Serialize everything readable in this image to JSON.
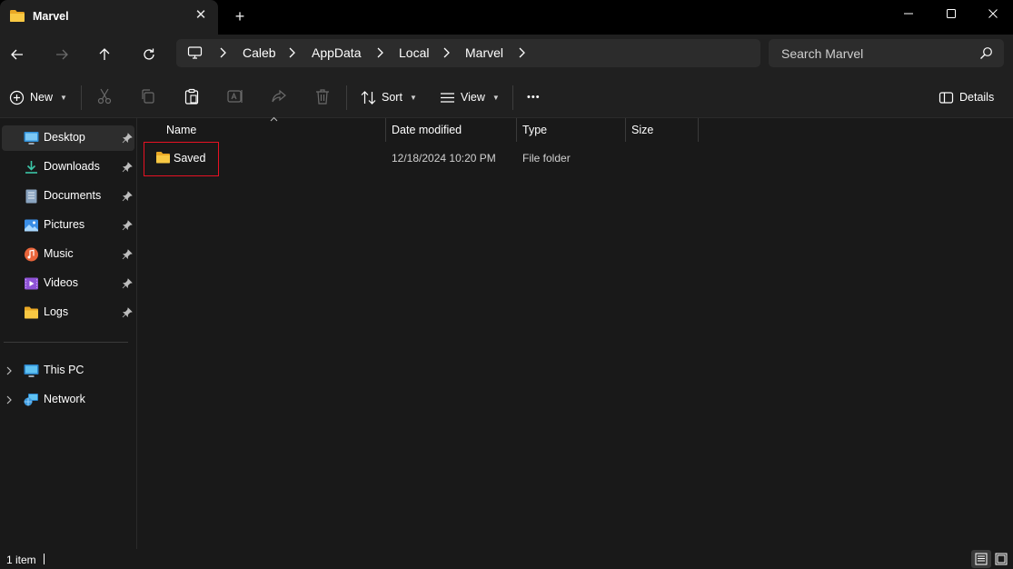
{
  "window": {
    "tab_title": "Marvel",
    "new_tab_symbol": "+",
    "close_tab_symbol": "✕"
  },
  "address": {
    "crumbs": [
      "Caleb",
      "AppData",
      "Local",
      "Marvel"
    ],
    "search_placeholder": "Search Marvel"
  },
  "toolbar": {
    "new_label": "New",
    "sort_label": "Sort",
    "view_label": "View",
    "more_label": "•••",
    "details_label": "Details"
  },
  "sidebar": {
    "quick_access": [
      {
        "label": "Desktop",
        "icon": "desktop-icon",
        "pinned": true,
        "active": true
      },
      {
        "label": "Downloads",
        "icon": "downloads-icon",
        "pinned": true
      },
      {
        "label": "Documents",
        "icon": "documents-icon",
        "pinned": true
      },
      {
        "label": "Pictures",
        "icon": "pictures-icon",
        "pinned": true
      },
      {
        "label": "Music",
        "icon": "music-icon",
        "pinned": true
      },
      {
        "label": "Videos",
        "icon": "videos-icon",
        "pinned": true
      },
      {
        "label": "Logs",
        "icon": "folder-icon",
        "pinned": true
      }
    ],
    "locations": [
      {
        "label": "This PC",
        "icon": "this-pc-icon"
      },
      {
        "label": "Network",
        "icon": "network-icon"
      }
    ]
  },
  "columns": {
    "name": "Name",
    "date_modified": "Date modified",
    "type": "Type",
    "size": "Size"
  },
  "files": [
    {
      "name": "Saved",
      "date_modified": "12/18/2024 10:20 PM",
      "type": "File folder",
      "size": ""
    }
  ],
  "status": {
    "item_count": "1 item"
  },
  "colors": {
    "accent": "#4cc2ff",
    "folder": "#f8c843",
    "highlight_box": "#e81123"
  }
}
